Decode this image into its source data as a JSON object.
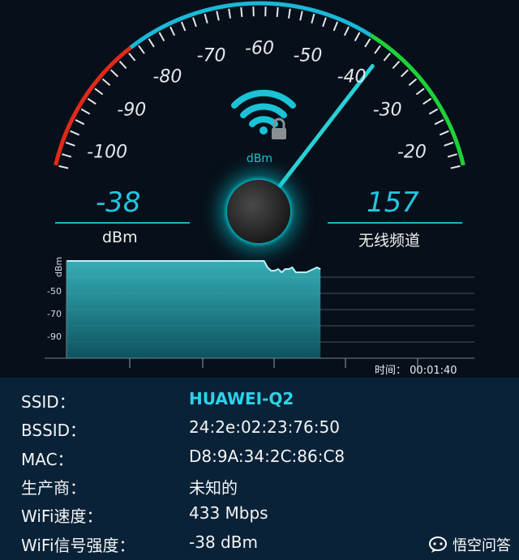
{
  "gauge": {
    "tick_labels": [
      "-100",
      "-90",
      "-80",
      "-70",
      "-60",
      "-50",
      "-40",
      "-30",
      "-20"
    ],
    "center_unit": "dBm",
    "reading": -38,
    "colors": {
      "arc_low": "#e02a1a",
      "arc_mid": "#1ab8d8",
      "arc_high": "#1ed23a",
      "needle": "#2ad0d8"
    },
    "icon": "wifi-lock-icon"
  },
  "stats": {
    "signal_value": "-38",
    "signal_unit": "dBm",
    "channel_value": "157",
    "channel_label": "无线频道"
  },
  "chart": {
    "y_axis_label": "dBm",
    "y_ticks": [
      "-50",
      "-70",
      "-90"
    ],
    "time_label": "时间：",
    "time_value": "00:01:40"
  },
  "chart_data": {
    "type": "area",
    "ylabel": "dBm",
    "ylim": [
      -100,
      -40
    ],
    "series": [
      {
        "values": [
          -40,
          -40,
          -40,
          -40,
          -40,
          -40,
          -40,
          -40,
          -40,
          -40,
          -40,
          -40,
          -40,
          -40,
          -40,
          -40,
          -40,
          -40,
          -40,
          -40,
          -40,
          -40,
          -40,
          -40,
          -40,
          -40,
          -40,
          -40,
          -40,
          -40,
          -40,
          -40,
          -40,
          -40,
          -40,
          -40,
          -40,
          -40,
          -40,
          -40,
          -40,
          -40,
          -40,
          -40,
          -40,
          -40,
          -40,
          -40,
          -40,
          -40,
          -40,
          -40,
          -40,
          -40,
          -40,
          -40,
          -40,
          -44,
          -46,
          -46,
          -45,
          -47,
          -45,
          -45,
          -44,
          -47,
          -47,
          -47,
          -47,
          -46,
          -45,
          -44,
          -45
        ]
      }
    ],
    "grid": true
  },
  "info": {
    "rows": [
      {
        "key": "SSID：",
        "value": "HUAWEI-Q2"
      },
      {
        "key": "BSSID：",
        "value": "24:2e:02:23:76:50"
      },
      {
        "key": "MAC：",
        "value": "D8:9A:34:2C:86:C8"
      },
      {
        "key": "生产商：",
        "value": "未知的"
      },
      {
        "key": "WiFi速度：",
        "value": "433 Mbps"
      },
      {
        "key": "WiFi信号强度：",
        "value": "-38 dBm"
      }
    ]
  },
  "watermark": {
    "text": "悟空问答",
    "icon": "speech-bubble-icon"
  }
}
